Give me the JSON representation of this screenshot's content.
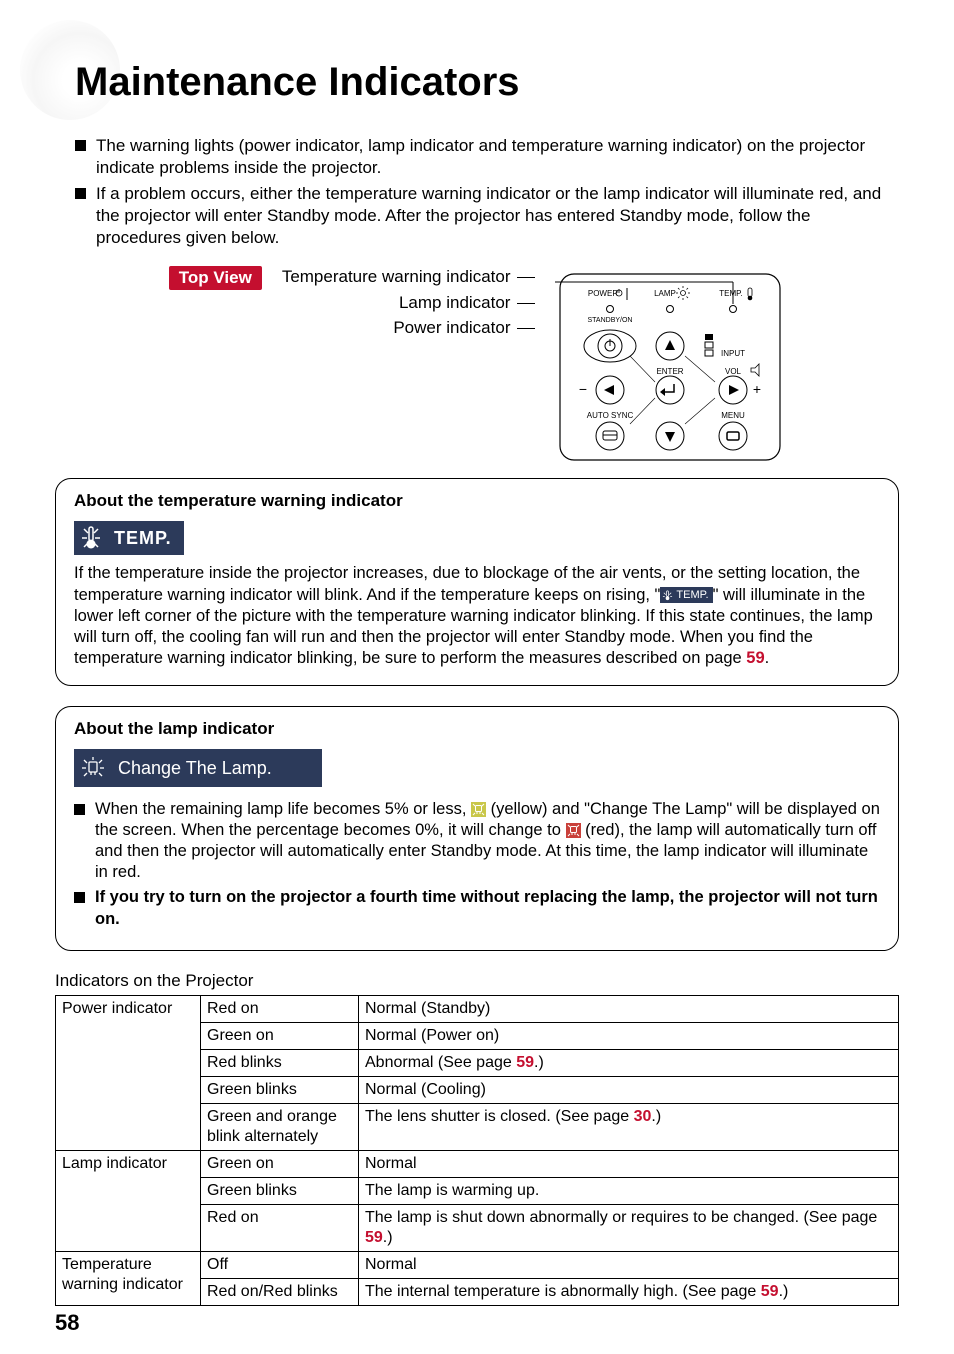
{
  "title": "Maintenance Indicators",
  "intro_bullets": [
    "The warning lights (power indicator, lamp indicator and temperature warning indicator) on the projector indicate problems inside the projector.",
    "If a problem occurs, either the temperature warning indicator or the lamp indicator will illuminate red, and the projector will enter Standby mode. After the projector has entered Standby mode, follow the procedures given below."
  ],
  "top_view": {
    "badge": "Top View",
    "lines": [
      "Temperature warning indicator",
      "Lamp indicator",
      "Power indicator"
    ],
    "panel": {
      "power": "POWER",
      "lamp": "LAMP",
      "temp": "TEMP.",
      "standby": "STANDBY/ON",
      "input": "INPUT",
      "enter": "ENTER",
      "vol": "VOL",
      "autosync": "AUTO SYNC",
      "menu": "MENU"
    }
  },
  "temp_box": {
    "heading": "About the temperature warning indicator",
    "badge": "TEMP.",
    "para_before": "If the temperature inside the projector increases, due to blockage of the air vents, or the setting location, the temperature warning indicator will blink. And if the temperature keeps on rising, \"",
    "inline_chip": "TEMP.",
    "para_after": "\" will illuminate in the lower left corner of the picture with the temperature warning indicator blinking. If this state continues, the lamp will turn off, the cooling fan will run and then the projector will enter Standby mode. When you find the temperature warning indicator blinking, be sure to perform the measures described on page ",
    "page_ref": "59",
    "tail": "."
  },
  "lamp_box": {
    "heading": "About the lamp indicator",
    "badge": "Change The Lamp.",
    "b1_a": "When the remaining lamp life becomes 5% or less, ",
    "b1_b": " (yellow) and \"Change The Lamp\" will be displayed on the screen. When the percentage becomes 0%, it will change to ",
    "b1_c": " (red), the lamp will automatically turn off and then the projector will automatically enter Standby mode. At this time, the lamp indicator will illuminate in red.",
    "b2": "If you try to turn on the projector a fourth time without replacing the lamp, the projector will not turn on."
  },
  "table_caption": "Indicators on the Projector",
  "table": {
    "groups": [
      {
        "name": "Power indicator",
        "rows": [
          {
            "state": "Red on",
            "desc_a": "Normal (Standby)",
            "ref": null,
            "desc_b": ""
          },
          {
            "state": "Green on",
            "desc_a": "Normal (Power on)",
            "ref": null,
            "desc_b": ""
          },
          {
            "state": "Red blinks",
            "desc_a": "Abnormal (See page ",
            "ref": "59",
            "desc_b": ".)"
          },
          {
            "state": "Green blinks",
            "desc_a": "Normal (Cooling)",
            "ref": null,
            "desc_b": ""
          },
          {
            "state": "Green and orange blink alternately",
            "desc_a": "The lens shutter is closed. (See page ",
            "ref": "30",
            "desc_b": ".)"
          }
        ]
      },
      {
        "name": "Lamp indicator",
        "rows": [
          {
            "state": "Green on",
            "desc_a": "Normal",
            "ref": null,
            "desc_b": ""
          },
          {
            "state": "Green blinks",
            "desc_a": "The lamp is warming up.",
            "ref": null,
            "desc_b": ""
          },
          {
            "state": "Red on",
            "desc_a": "The lamp is shut down abnormally or requires to be changed. (See page ",
            "ref": "59",
            "desc_b": ".)"
          }
        ]
      },
      {
        "name": "Temperature warning indicator",
        "rows": [
          {
            "state": "Off",
            "desc_a": "Normal",
            "ref": null,
            "desc_b": ""
          },
          {
            "state": "Red on/Red blinks",
            "desc_a": "The internal temperature is abnormally high. (See page ",
            "ref": "59",
            "desc_b": ".)"
          }
        ]
      }
    ]
  },
  "page_number": "58"
}
